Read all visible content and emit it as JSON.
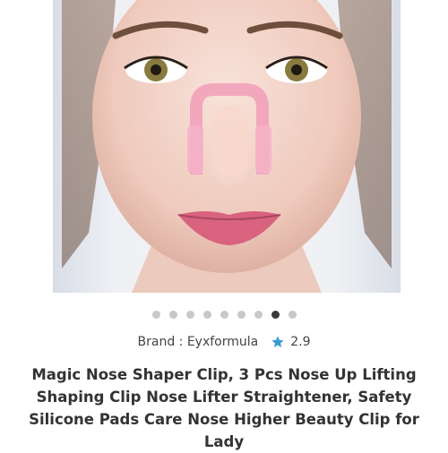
{
  "product": {
    "brand_label": "Brand : Eyxformula",
    "rating": "2.9",
    "rating_icon": "star-icon",
    "title": "Magic Nose Shaper Clip, 3 Pcs Nose Up Lifting Shaping Clip Nose Lifter Straightener, Safety Silicone Pads Care Nose Higher Beauty Clip for Lady",
    "image_alt": "woman wearing pink nose clip"
  },
  "carousel": {
    "total": 9,
    "active_index": 7
  },
  "colors": {
    "dot_inactive": "#c8c8c8",
    "dot_active": "#3a3a3a",
    "star": "#3b9ad9",
    "clip": "#f19db8"
  }
}
